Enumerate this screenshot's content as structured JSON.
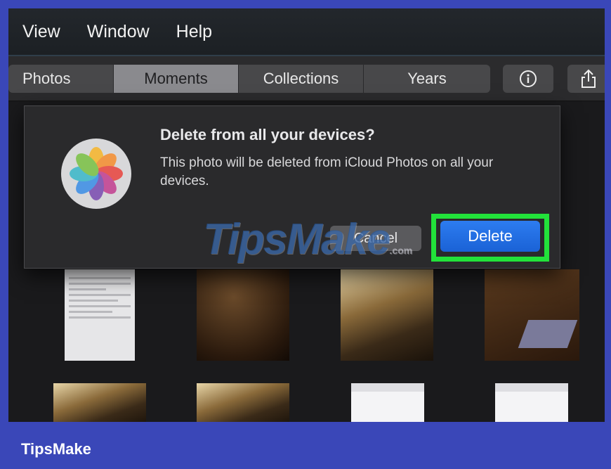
{
  "menubar": {
    "items": [
      "View",
      "Window",
      "Help"
    ]
  },
  "toolbar": {
    "tabs": [
      {
        "label": "Photos",
        "active": false
      },
      {
        "label": "Moments",
        "active": true
      },
      {
        "label": "Collections",
        "active": false
      },
      {
        "label": "Years",
        "active": false
      }
    ],
    "buttons": [
      {
        "icon": "info-icon"
      },
      {
        "icon": "share-icon"
      }
    ]
  },
  "dialog": {
    "app_icon": "photos-app-icon",
    "title": "Delete from all your devices?",
    "message": "This photo will be deleted from iCloud Photos on all your devices.",
    "cancel_label": "Cancel",
    "delete_label": "Delete",
    "highlight_color": "#22e23a",
    "delete_color": "#1a62d6"
  },
  "watermark": {
    "text": "TipsMake",
    "suffix": ".com"
  },
  "footer": {
    "brand": "TipsMake"
  },
  "colors": {
    "border": "#3a47b8"
  }
}
